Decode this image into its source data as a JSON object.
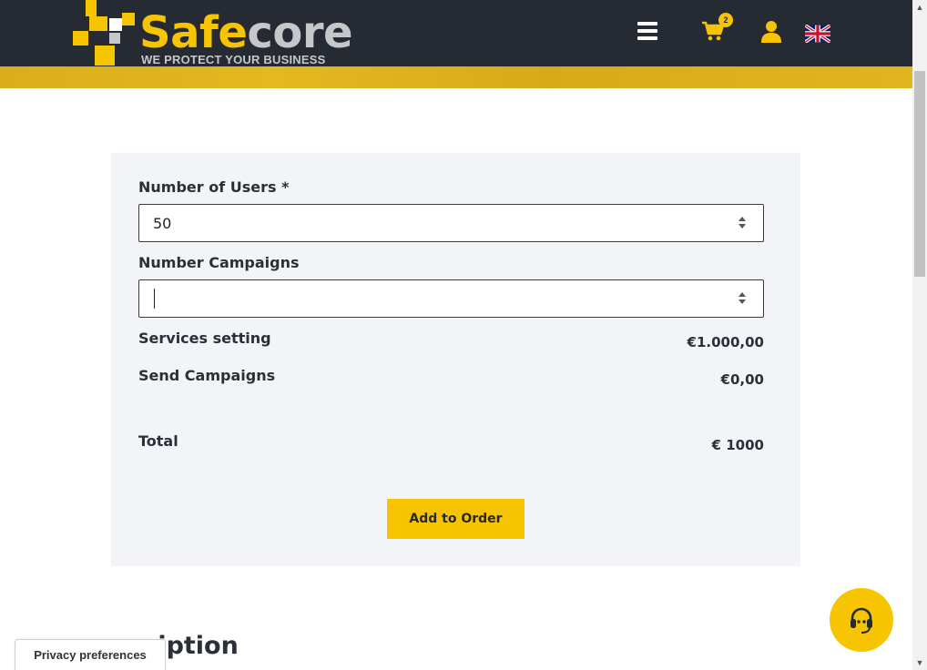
{
  "header": {
    "logo_primary": "Safe",
    "logo_secondary": "core",
    "tagline": "WE PROTECT YOUR BUSINESS",
    "menu_icon": "hamburger-menu-icon",
    "cart_icon": "shopping-cart-icon",
    "cart_count": "2",
    "user_icon": "user-icon",
    "language_icon": "uk-flag-icon",
    "background": "#262a33",
    "accent": "#f6c400"
  },
  "form": {
    "users_label": "Number of Users *",
    "users_value": "50",
    "campaigns_label": "Number Campaigns",
    "campaigns_value": "",
    "services_label": "Services setting",
    "services_value": "€1.000,00",
    "send_label": "Send Campaigns",
    "send_value": "€0,00",
    "total_label": "Total",
    "total_value": "€ 1000",
    "add_button": "Add to Order"
  },
  "section": {
    "title_partial": "ription"
  },
  "privacy": {
    "label": "Privacy preferences"
  },
  "support": {
    "icon": "headset-support-icon"
  }
}
